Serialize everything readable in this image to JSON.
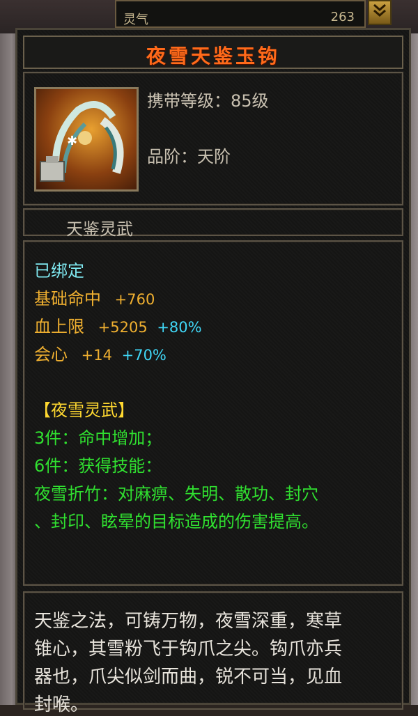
{
  "background": {
    "stat_label": "灵气",
    "stat_value": "263",
    "toggle_icon": "double-chevron-down-icon"
  },
  "item": {
    "name": "夜雪天鉴玉钩",
    "name_color": "#ff6a1a",
    "icon": "jade-hook-weapon-icon",
    "carry_level": "携带等级：85级",
    "grade": "品阶：天阶",
    "category": "天鉴灵武"
  },
  "attributes": {
    "bind_status": "已绑定",
    "hit": {
      "label": "基础命中",
      "value": "+760"
    },
    "hp": {
      "label": "血上限",
      "value": "+5205",
      "bonus": "+80%"
    },
    "crit": {
      "label": "会心",
      "value": "+14",
      "bonus": "+70%"
    },
    "set_name": "【夜雪灵武】",
    "set_bonus_3": "3件：命中增加；",
    "set_bonus_6": "6件：获得技能：",
    "skill_line_1": "夜雪折竹：对麻痹、失明、散功、封穴",
    "skill_line_2": "、封印、眩晕的目标造成的伤害提高。"
  },
  "description": [
    "天鉴之法，可铸万物，夜雪深重，寒草",
    "锥心，其雪粉飞于钩爪之尖。钩爪亦兵",
    "器也，爪尖似剑而曲，锐不可当，见血",
    "封喉。"
  ],
  "colors": {
    "cyan_text": "#7fe8f0",
    "orange_text": "#f0b030",
    "bonus_text": "#40d8f8",
    "set_name": "#ffd830",
    "green_text": "#30e030",
    "white_text": "#e8e4dc",
    "gray_text": "#c8c0b0"
  }
}
